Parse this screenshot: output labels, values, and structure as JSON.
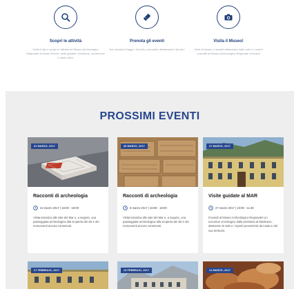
{
  "features": [
    {
      "icon": "search-icon",
      "title": "Scopri le attività",
      "desc": "Visita il sito e scopri le attività del Museo Archeologico Regionale di Aosta: Eventi, visite guidate, workshop, conferenze e molto altro!"
    },
    {
      "icon": "ticket-icon",
      "title": "Prenota gli eventi",
      "desc": "Non bisolarti d'oggi e l'evento, prenotalo direttamente dal sito!"
    },
    {
      "icon": "camera-icon",
      "title": "Visita il Museo!",
      "desc": "Vieni al Museo e lasciati affascinare dalle sale e i reperti custoditi al Museo Archeologico Regionale di Aosta!"
    }
  ],
  "events_section": {
    "title": "PROSSIMI EVENTI"
  },
  "events": [
    {
      "date_badge": "22 MARZO, 2017",
      "title": "Racconti di archeologia",
      "datetime": "22 marzo 2017 | 16:00 - 18:00",
      "desc": "Visita tematica alle sale del Mar e, a seguire, una passeggiata archeologica alla scoperta dei siti e dei monumenti ancora conservati."
    },
    {
      "date_badge": "08 MARZO, 2017",
      "title": "Racconti di archeologia",
      "datetime": "8 marzo 2017 | 16:00 - 18:00",
      "desc": "Visita tematica alle sale del Mar e, a seguire, una passeggiata archeologica alla scoperta dei siti e dei monumenti ancora conservati."
    },
    {
      "date_badge": "27 MARZO, 2017",
      "title": "Visite guidate al MAR",
      "datetime": "27 marzo 2017 | 10:00 - 11:30",
      "desc": "Il lunedì al Museo Archeologico Regionale! Un excursus cronologico dalla preistoria al Medioevo, attraverso le sale e i reperti provenienti da Aosta e dal suo territorio."
    },
    {
      "date_badge": "27 FEBBRAIO, 2017"
    },
    {
      "date_badge": "15 FEBBRAIO, 2017"
    },
    {
      "date_badge": "14 MARZO, 2017"
    }
  ],
  "colors": {
    "brand": "#27468c",
    "section_bg": "#eeeeee"
  }
}
